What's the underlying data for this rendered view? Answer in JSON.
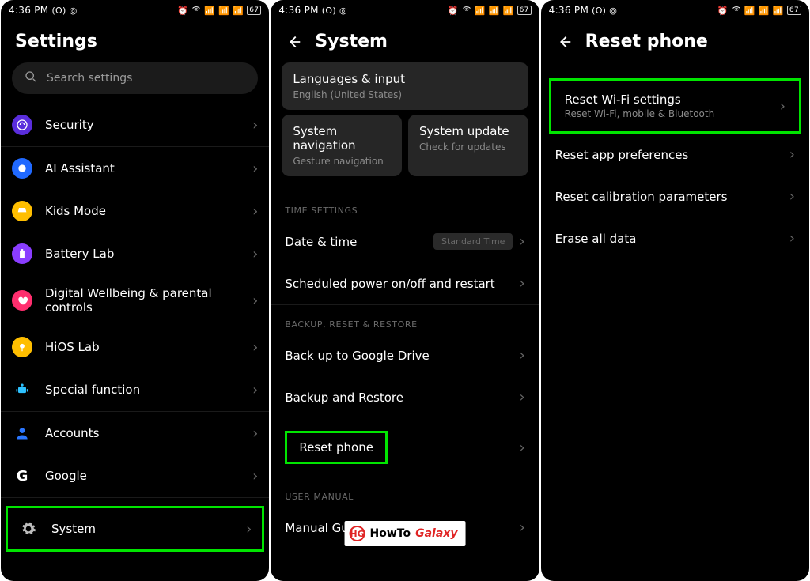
{
  "status": {
    "time": "4:36 PM",
    "left_icons": [
      "(O)",
      "◎"
    ],
    "right_icons": [
      "⏰",
      "📶",
      "📶",
      "📶"
    ],
    "battery": "67"
  },
  "screen1": {
    "title": "Settings",
    "search_placeholder": "Search settings",
    "rows": [
      {
        "icon_name": "security-icon",
        "label": "Security"
      },
      {
        "icon_name": "ai-assistant-icon",
        "label": "AI Assistant"
      },
      {
        "icon_name": "kids-mode-icon",
        "label": "Kids Mode"
      },
      {
        "icon_name": "battery-lab-icon",
        "label": "Battery Lab"
      },
      {
        "icon_name": "wellbeing-icon",
        "label": "Digital Wellbeing & parental controls"
      },
      {
        "icon_name": "hios-lab-icon",
        "label": "HiOS Lab"
      },
      {
        "icon_name": "special-fn-icon",
        "label": "Special function"
      },
      {
        "icon_name": "accounts-icon",
        "label": "Accounts"
      },
      {
        "icon_name": "google-icon",
        "label": "Google"
      },
      {
        "icon_name": "system-icon",
        "label": "System"
      }
    ]
  },
  "screen2": {
    "title": "System",
    "card_lang": {
      "title": "Languages & input",
      "sub": "English (United States)"
    },
    "card_nav": {
      "title": "System navigation",
      "sub": "Gesture navigation"
    },
    "card_update": {
      "title": "System update",
      "sub": "Check for updates"
    },
    "section_time": "TIME SETTINGS",
    "row_date": {
      "label": "Date & time",
      "value": "Standard Time"
    },
    "row_sched": {
      "label": "Scheduled power on/off and restart"
    },
    "section_backup": "BACKUP, RESET & RESTORE",
    "row_gdrive": {
      "label": "Back up to Google Drive"
    },
    "row_br": {
      "label": "Backup and Restore"
    },
    "row_reset": {
      "label": "Reset phone"
    },
    "section_manual": "USER MANUAL",
    "row_manual": {
      "label": "Manual Guide"
    }
  },
  "screen3": {
    "title": "Reset phone",
    "rows": [
      {
        "label": "Reset Wi-Fi settings",
        "sub": "Reset Wi-Fi, mobile & Bluetooth"
      },
      {
        "label": "Reset app preferences"
      },
      {
        "label": "Reset calibration parameters"
      },
      {
        "label": "Erase all data"
      }
    ]
  },
  "watermark": {
    "brand": "HowTo",
    "brand2": "Galaxy",
    "glyph": "HG"
  }
}
